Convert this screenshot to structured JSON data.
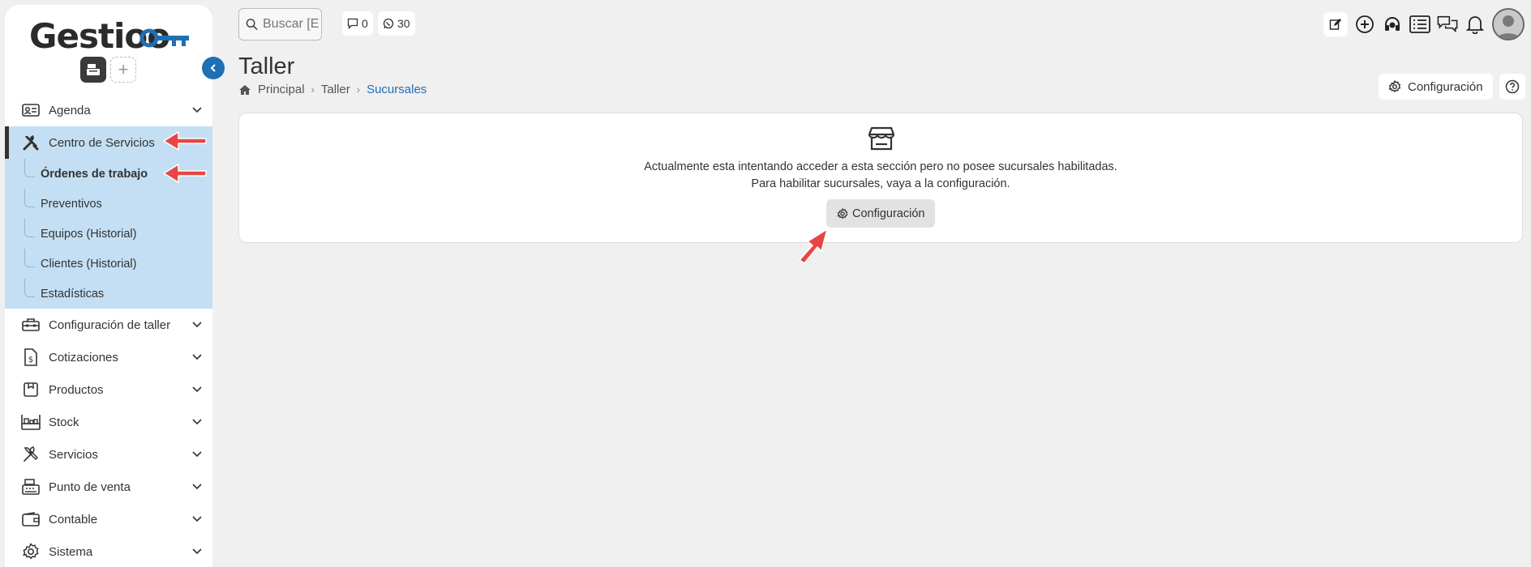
{
  "app": {
    "logo_text": "Gestioo",
    "logo_key_text": "o"
  },
  "search": {
    "placeholder": "Buscar [E"
  },
  "chips": {
    "comments_count": "0",
    "whatsapp_count": "30"
  },
  "page": {
    "title": "Taller",
    "breadcrumb": [
      "Principal",
      "Taller",
      "Sucursales"
    ],
    "config_label": "Configuración"
  },
  "sidebar": {
    "items": [
      {
        "label": "Agenda",
        "icon": "contact-card-icon"
      },
      {
        "label": "Centro de Servicios",
        "icon": "tools-icon"
      },
      {
        "label": "Configuración de taller",
        "icon": "toolbox-icon"
      },
      {
        "label": "Cotizaciones",
        "icon": "dollar-document-icon"
      },
      {
        "label": "Productos",
        "icon": "box-icon"
      },
      {
        "label": "Stock",
        "icon": "shelf-icon"
      },
      {
        "label": "Servicios",
        "icon": "tools-icon"
      },
      {
        "label": "Punto de venta",
        "icon": "cash-register-icon"
      },
      {
        "label": "Contable",
        "icon": "wallet-icon"
      },
      {
        "label": "Sistema",
        "icon": "gear-icon"
      }
    ],
    "sub_items": [
      {
        "label": "Órdenes de trabajo"
      },
      {
        "label": "Preventivos"
      },
      {
        "label": "Equipos (Historial)"
      },
      {
        "label": "Clientes (Historial)"
      },
      {
        "label": "Estadísticas"
      }
    ]
  },
  "notice": {
    "line1": "Actualmente esta intentando acceder a esta sección pero no posee sucursales habilitadas.",
    "line2": "Para habilitar sucursales, vaya a la configuración.",
    "button_label": "Configuración",
    "icon": "store-icon"
  },
  "colors": {
    "accent": "#1f6fb5",
    "active_group_bg": "#c4dff3",
    "annotation_arrow": "#e84545"
  }
}
